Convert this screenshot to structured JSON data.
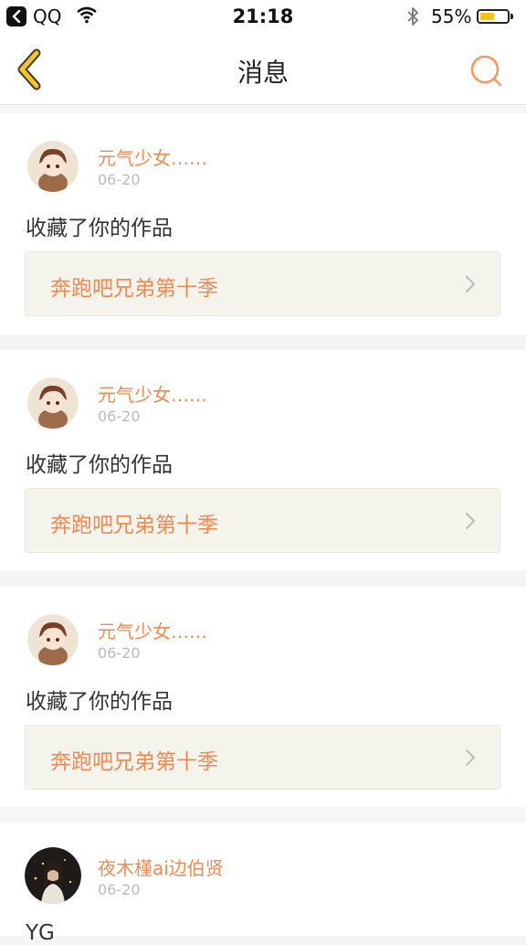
{
  "status_bar": {
    "carrier": "QQ",
    "time": "21:18",
    "battery": "55%",
    "battery_level": 0.55
  },
  "nav": {
    "title": "消息"
  },
  "messages": [
    {
      "username": "元气少女……",
      "date": "06-20",
      "action": "收藏了你的作品",
      "work_title": "奔跑吧兄弟第十季"
    },
    {
      "username": "元气少女……",
      "date": "06-20",
      "action": "收藏了你的作品",
      "work_title": "奔跑吧兄弟第十季"
    },
    {
      "username": "元气少女……",
      "date": "06-20",
      "action": "收藏了你的作品",
      "work_title": "奔跑吧兄弟第十季"
    },
    {
      "username": "夜木槿ai边伯贤",
      "date": "06-20",
      "action": "YG"
    }
  ],
  "colors": {
    "accent": "#f08a52",
    "back_arrow": "#f0c53a",
    "work_bg": "#f5f4ec"
  }
}
